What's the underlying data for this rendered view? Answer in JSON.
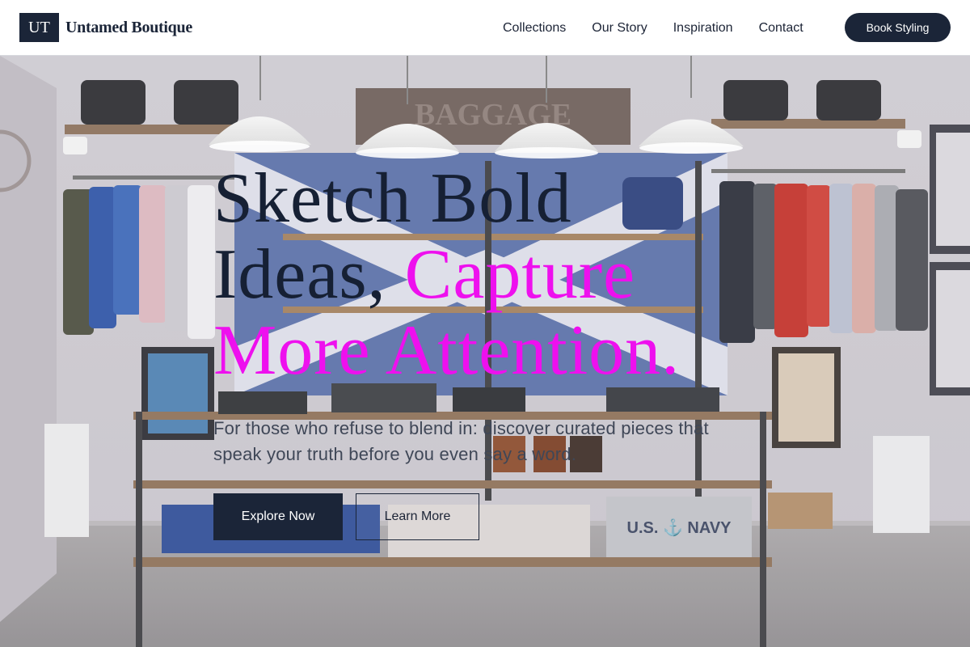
{
  "brand": {
    "logo_text": "UT",
    "name": "Untamed Boutique"
  },
  "nav": {
    "items": [
      {
        "label": "Collections"
      },
      {
        "label": "Our Story"
      },
      {
        "label": "Inspiration"
      },
      {
        "label": "Contact"
      }
    ],
    "cta_label": "Book Styling"
  },
  "hero": {
    "title_line1": "Sketch Bold",
    "title_line2_plain": "Ideas, ",
    "title_line2_accent": "Capture",
    "title_line3_accent": "More Attention.",
    "subtitle": "For those who refuse to blend in: discover curated pieces that speak your truth before you even say a word.",
    "primary_button": "Explore Now",
    "secondary_button": "Learn More",
    "background_image": "boutique-interior-photo"
  },
  "colors": {
    "navy": "#1b2538",
    "accent_magenta": "#ee10ee",
    "white": "#ffffff"
  }
}
